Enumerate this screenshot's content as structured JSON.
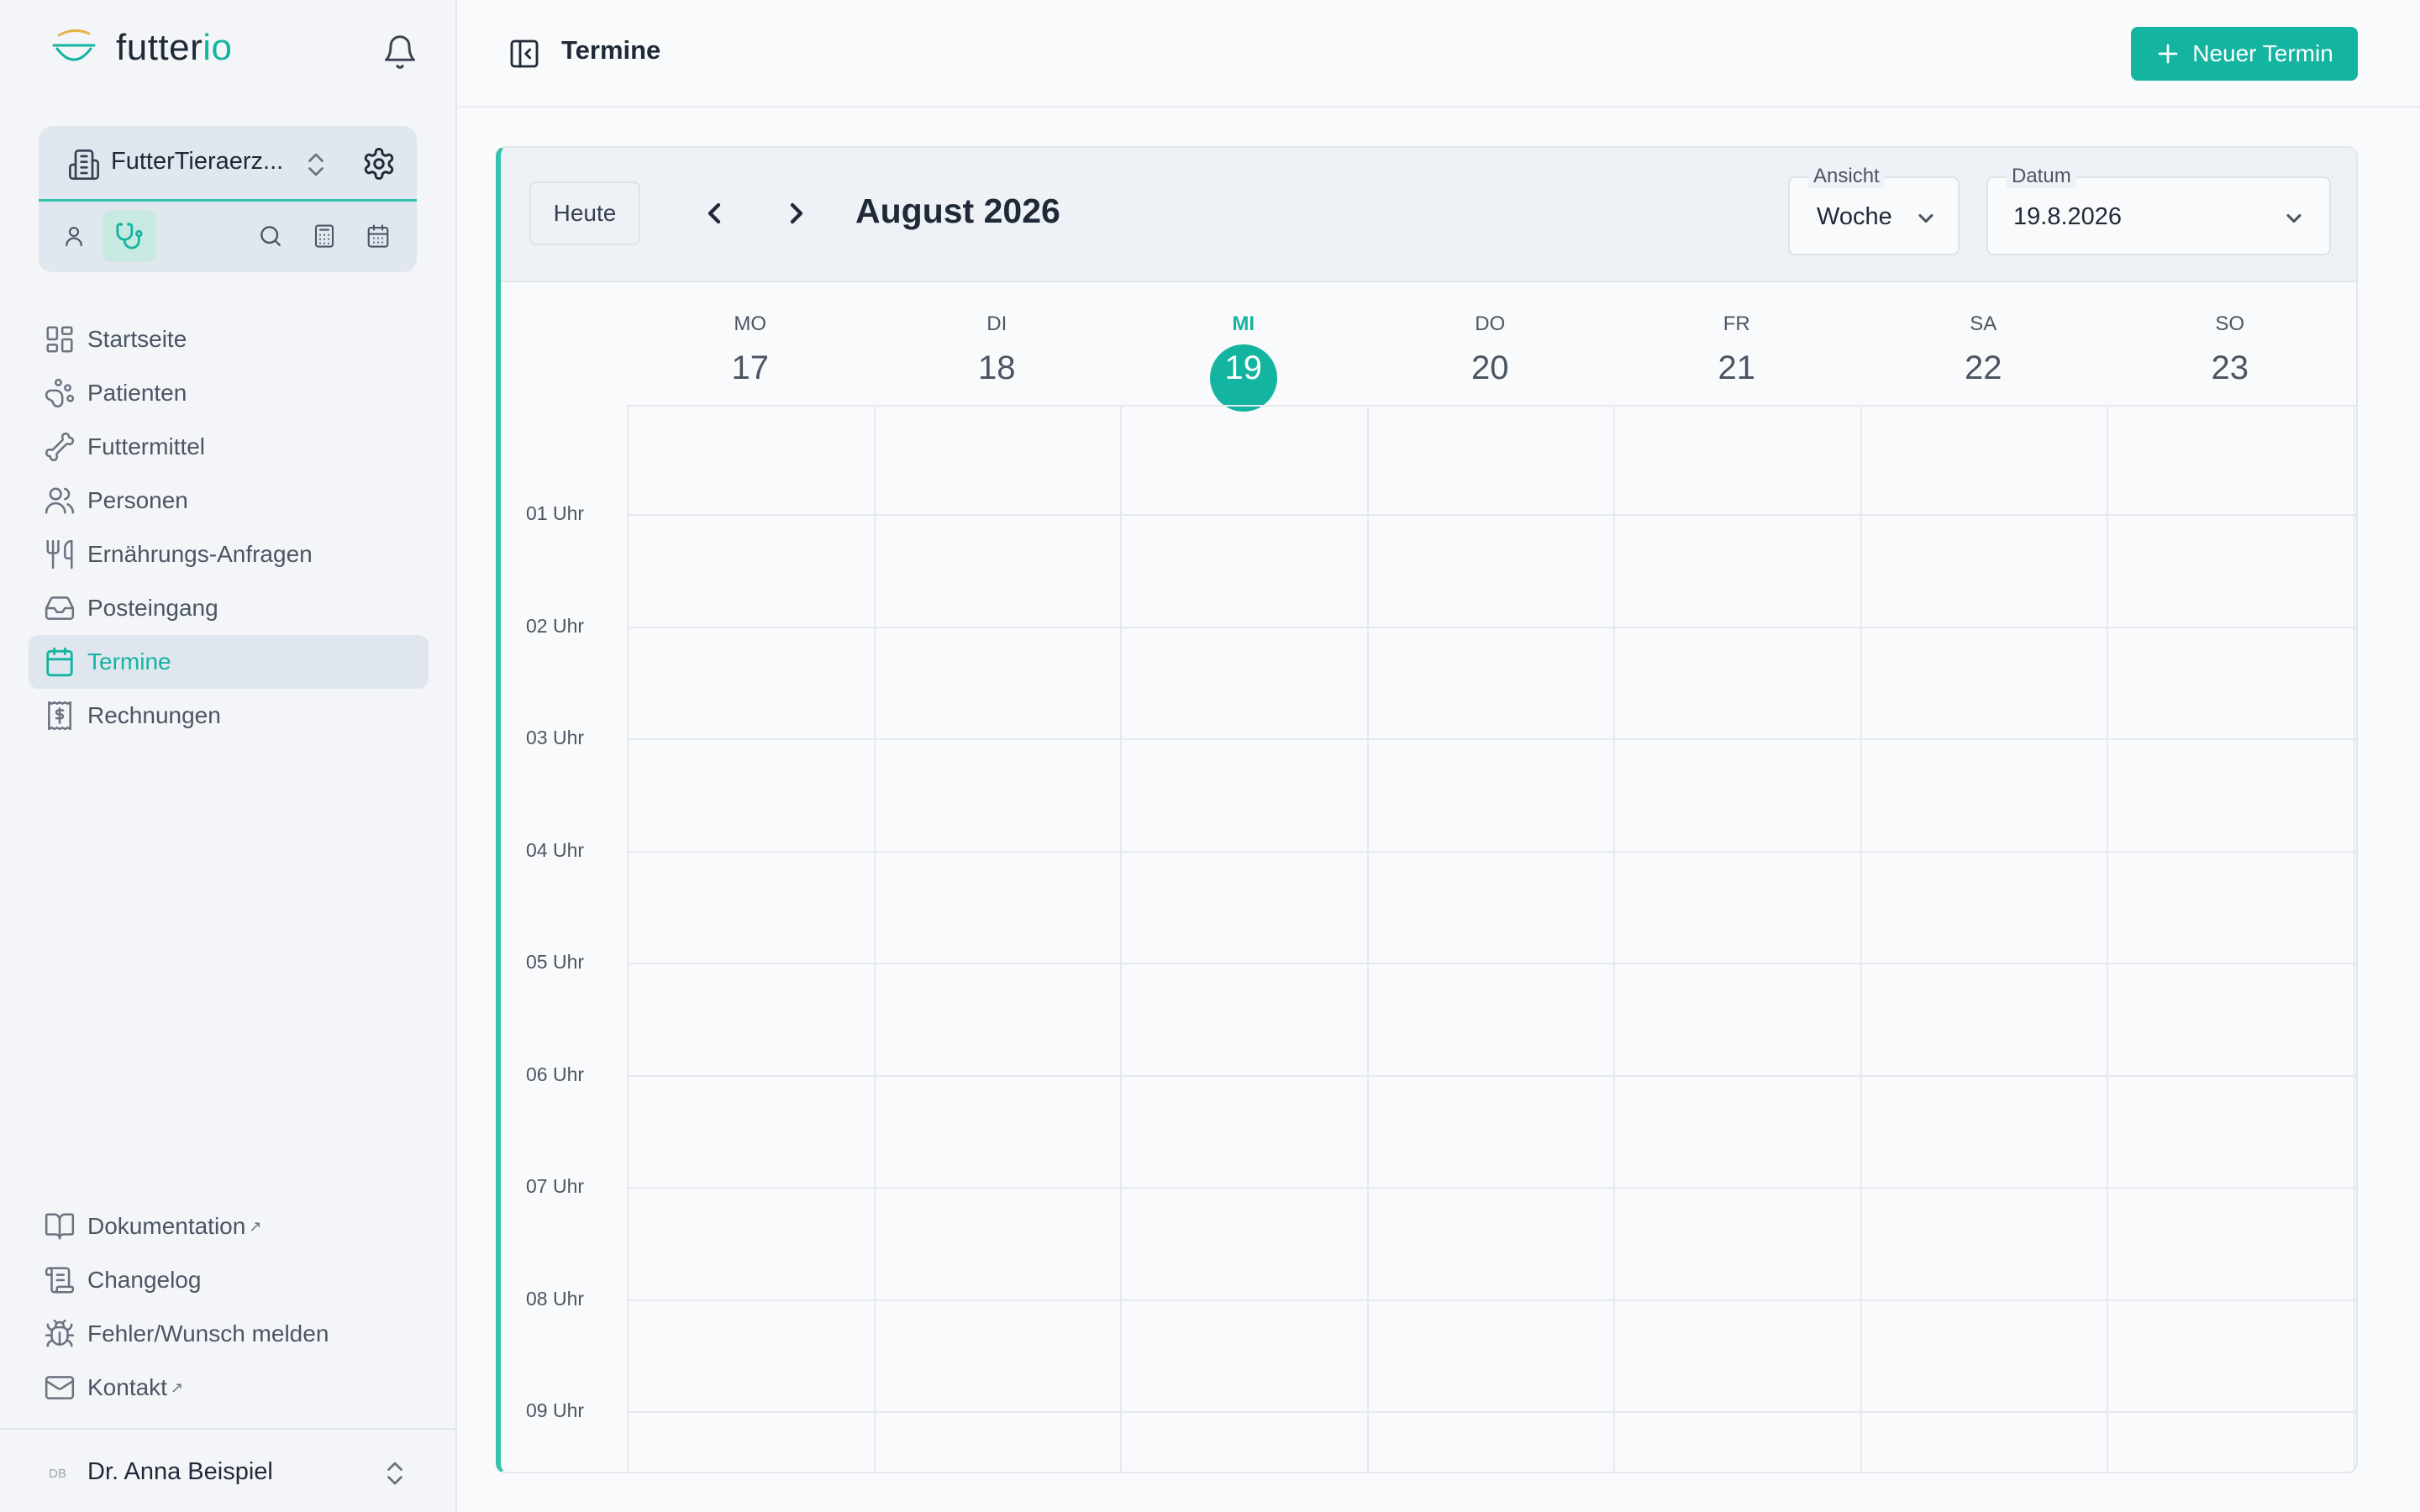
{
  "app": {
    "logo_text_main": "futter",
    "logo_text_accent": "io",
    "brand_color": "#13b5a0"
  },
  "org": {
    "name": "FutterTieraerz..."
  },
  "nav": {
    "items": [
      {
        "label": "Startseite",
        "icon": "dashboard-icon"
      },
      {
        "label": "Patienten",
        "icon": "paw-icon"
      },
      {
        "label": "Futtermittel",
        "icon": "bone-icon"
      },
      {
        "label": "Personen",
        "icon": "users-icon"
      },
      {
        "label": "Ernährungs-Anfragen",
        "icon": "utensils-icon"
      },
      {
        "label": "Posteingang",
        "icon": "inbox-icon"
      },
      {
        "label": "Termine",
        "icon": "calendar-icon",
        "active": true
      },
      {
        "label": "Rechnungen",
        "icon": "receipt-icon"
      }
    ],
    "bottom": [
      {
        "label": "Dokumentation",
        "external": true
      },
      {
        "label": "Changelog"
      },
      {
        "label": "Fehler/Wunsch melden"
      },
      {
        "label": "Kontakt",
        "external": true
      }
    ]
  },
  "user": {
    "initials": "DB",
    "name": "Dr. Anna Beispiel"
  },
  "topbar": {
    "title": "Termine",
    "new_button": "Neuer Termin"
  },
  "calendar": {
    "today_label": "Heute",
    "month_label": "August 2026",
    "view": {
      "legend": "Ansicht",
      "value": "Woche"
    },
    "date": {
      "legend": "Datum",
      "value": "19.8.2026"
    },
    "days": [
      {
        "dow": "MO",
        "num": "17"
      },
      {
        "dow": "DI",
        "num": "18"
      },
      {
        "dow": "MI",
        "num": "19",
        "today": true
      },
      {
        "dow": "DO",
        "num": "20"
      },
      {
        "dow": "FR",
        "num": "21"
      },
      {
        "dow": "SA",
        "num": "22"
      },
      {
        "dow": "SO",
        "num": "23"
      }
    ],
    "hours": [
      "01 Uhr",
      "02 Uhr",
      "03 Uhr",
      "04 Uhr",
      "05 Uhr",
      "06 Uhr",
      "07 Uhr",
      "08 Uhr",
      "09 Uhr"
    ]
  }
}
